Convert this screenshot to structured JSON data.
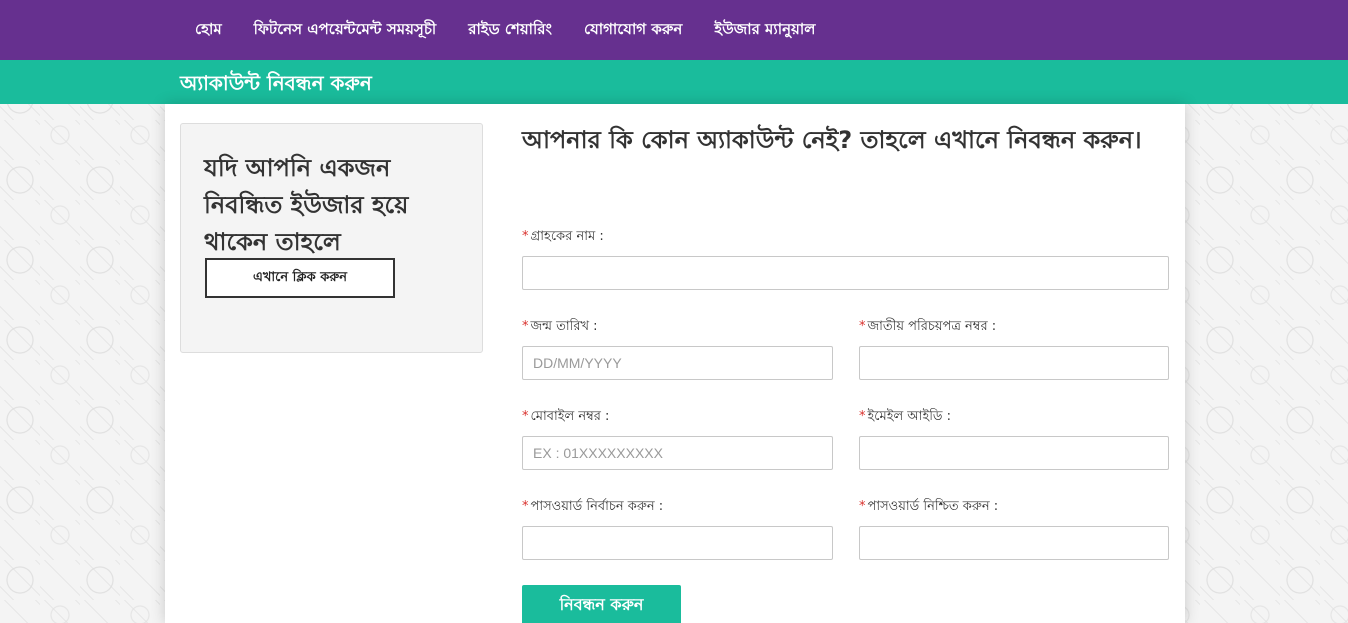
{
  "nav": {
    "items": [
      {
        "label": "হোম"
      },
      {
        "label": "ফিটনেস এপয়েন্টমেন্ট সময়সূচী"
      },
      {
        "label": "রাইড শেয়ারিং"
      },
      {
        "label": "যোগাযোগ করুন"
      },
      {
        "label": "ইউজার ম্যানুয়াল"
      }
    ]
  },
  "page": {
    "title": "অ্যাকাউন্ট নিবন্ধন করুন"
  },
  "login_box": {
    "heading": "যদি আপনি একজন নিবন্ধিত ইউজার হয়ে থাকেন তাহলে",
    "button_label": "এখানে ক্লিক করুন"
  },
  "form": {
    "title": "আপনার কি কোন অ্যাকাউন্ট নেই? তাহলে এখানে নিবন্ধন করুন।",
    "required_marker": "*",
    "customer_name": {
      "label": "গ্রাহকের নাম :",
      "value": "",
      "placeholder": ""
    },
    "birth_date": {
      "label": "জন্ম তারিখ :",
      "value": "",
      "placeholder": "DD/MM/YYYY"
    },
    "nid": {
      "label": "জাতীয় পরিচয়পত্র নম্বর :",
      "value": "",
      "placeholder": ""
    },
    "mobile": {
      "label": "মোবাইল নম্বর :",
      "value": "",
      "placeholder": "EX : 01XXXXXXXXX"
    },
    "email": {
      "label": "ইমেইল আইডি :",
      "value": "",
      "placeholder": ""
    },
    "password": {
      "label": "পাসওয়ার্ড নির্বাচন করুন :",
      "value": "",
      "placeholder": ""
    },
    "password_confirm": {
      "label": "পাসওয়ার্ড নিশ্চিত করুন :",
      "value": "",
      "placeholder": ""
    },
    "submit_label": "নিবন্ধন করুন"
  },
  "colors": {
    "nav_bg": "#66308f",
    "accent": "#1abc9c",
    "required": "#d9302c"
  }
}
